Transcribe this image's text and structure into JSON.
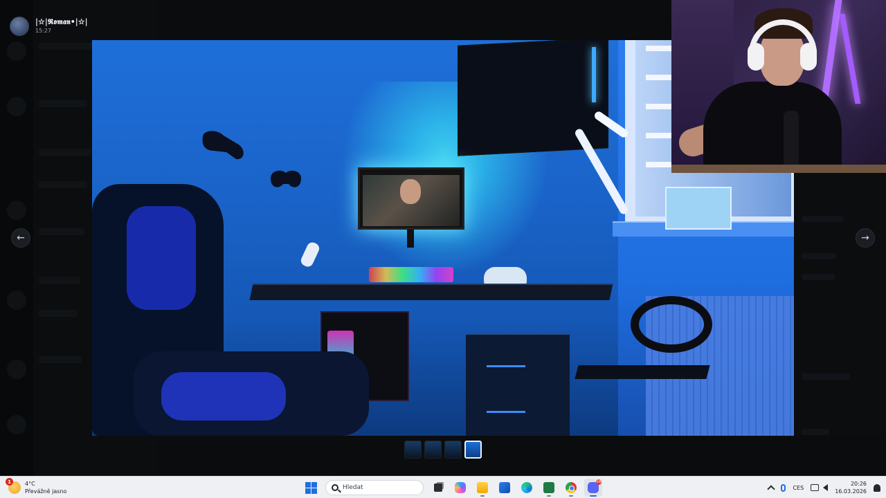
{
  "viewer": {
    "author_name": "|☆|𝕽𝖔𝖒𝖆𝖓•|☆|",
    "timestamp": "15:27",
    "prev_label": "←",
    "next_label": "→",
    "thumbnails": [
      {
        "active": false
      },
      {
        "active": false
      },
      {
        "active": false
      },
      {
        "active": true
      }
    ]
  },
  "taskbar": {
    "weather": {
      "badge": "1",
      "temperature": "4°C",
      "condition": "Převážně jasno"
    },
    "search_placeholder": "Hledat",
    "apps": [
      {
        "name": "task-view-icon",
        "open": false
      },
      {
        "name": "copilot-icon",
        "open": false
      },
      {
        "name": "file-explorer-icon",
        "open": true
      },
      {
        "name": "outlook-icon",
        "open": false
      },
      {
        "name": "edge-icon",
        "open": false
      },
      {
        "name": "excel-icon",
        "open": true
      },
      {
        "name": "chrome-icon",
        "open": true
      },
      {
        "name": "discord-icon",
        "open": true,
        "active": true,
        "badge": "58"
      }
    ],
    "tray": {
      "language": "CES",
      "time": "20:26",
      "date": "16.03.2026"
    }
  },
  "colors": {
    "accent": "#1f6fe0",
    "taskbar_bg": "#eef0f3",
    "viewer_bg": "#050607"
  }
}
